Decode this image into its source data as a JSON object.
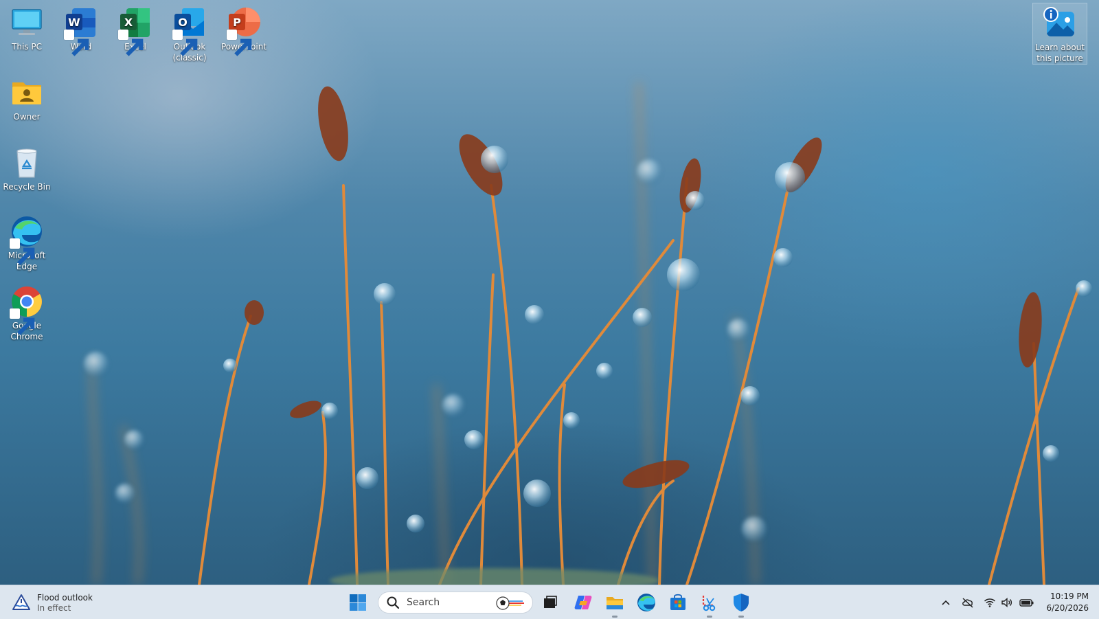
{
  "desktop": {
    "icons": [
      {
        "id": "this-pc",
        "label": "This PC"
      },
      {
        "id": "word",
        "label": "Word"
      },
      {
        "id": "excel",
        "label": "Excel"
      },
      {
        "id": "outlook",
        "label": "Outlook (classic)"
      },
      {
        "id": "powerpoint",
        "label": "PowerPoint"
      },
      {
        "id": "owner",
        "label": "Owner"
      },
      {
        "id": "recycle-bin",
        "label": "Recycle Bin"
      },
      {
        "id": "edge",
        "label": "Microsoft Edge"
      },
      {
        "id": "chrome",
        "label": "Google Chrome"
      }
    ],
    "learn_tile": {
      "label": "Learn about this picture"
    }
  },
  "taskbar": {
    "widget": {
      "title": "Flood outlook",
      "subtitle": "In effect"
    },
    "search": {
      "placeholder": "Search"
    },
    "pinned_apps": [
      {
        "id": "task-view",
        "icon": "task-view-icon"
      },
      {
        "id": "copilot",
        "icon": "copilot-icon"
      },
      {
        "id": "file-explorer",
        "icon": "folder-icon"
      },
      {
        "id": "edge",
        "icon": "edge-icon"
      },
      {
        "id": "store",
        "icon": "store-icon"
      },
      {
        "id": "snipping-tool",
        "icon": "snipping-tool-icon"
      },
      {
        "id": "defender",
        "icon": "shield-icon"
      }
    ],
    "tray": {
      "icons": [
        "chevron-up-icon",
        "cloud-offline-icon",
        "wifi-icon",
        "volume-icon",
        "battery-icon"
      ]
    },
    "clock": {
      "time": "10:19 PM",
      "date": "6/20/2026"
    }
  },
  "colors": {
    "taskbar_bg": "#dde6ef",
    "accent": "#0067c0",
    "wallpaper_blue": "#3c7aa0",
    "stem_orange": "#e08a3a"
  }
}
